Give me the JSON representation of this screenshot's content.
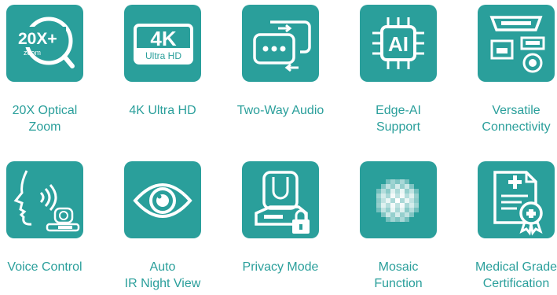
{
  "theme": {
    "tile_color": "#2a9f9b",
    "label_color": "#2a9f9b",
    "icon_color": "#ffffff"
  },
  "features": [
    {
      "label": "20X Optical\nZoom",
      "icon": "zoom-icon",
      "icon_text": "20X+",
      "icon_subtext": "zoom"
    },
    {
      "label": "4K Ultra HD",
      "icon": "4k-icon",
      "icon_text": "4K",
      "icon_subtext": "Ultra HD"
    },
    {
      "label": "Two-Way Audio",
      "icon": "two-way-audio-icon"
    },
    {
      "label": "Edge-AI\nSupport",
      "icon": "ai-chip-icon",
      "icon_text": "AI"
    },
    {
      "label": "Versatile\nConnectivity",
      "icon": "ports-icon"
    },
    {
      "label": "Voice Control",
      "icon": "voice-control-icon"
    },
    {
      "label": "Auto\nIR Night View",
      "icon": "eye-icon"
    },
    {
      "label": "Privacy Mode",
      "icon": "privacy-camera-icon"
    },
    {
      "label": "Mosaic\nFunction",
      "icon": "mosaic-icon"
    },
    {
      "label": "Medical Grade\nCertification",
      "icon": "certificate-icon"
    }
  ]
}
